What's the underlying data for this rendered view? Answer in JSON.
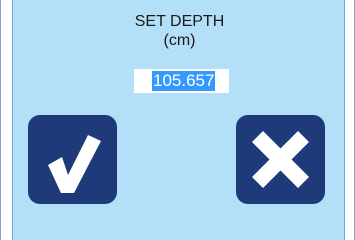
{
  "dialog": {
    "title": "SET DEPTH",
    "unit": "(cm)",
    "depth_value": "105.657"
  },
  "buttons": {
    "confirm_icon": "checkmark-icon",
    "cancel_icon": "x-icon"
  },
  "colors": {
    "dialog_background": "#b4dff9",
    "button_background": "#1f3a78",
    "icon_color": "#ffffff",
    "selection_highlight": "#3399ff"
  }
}
